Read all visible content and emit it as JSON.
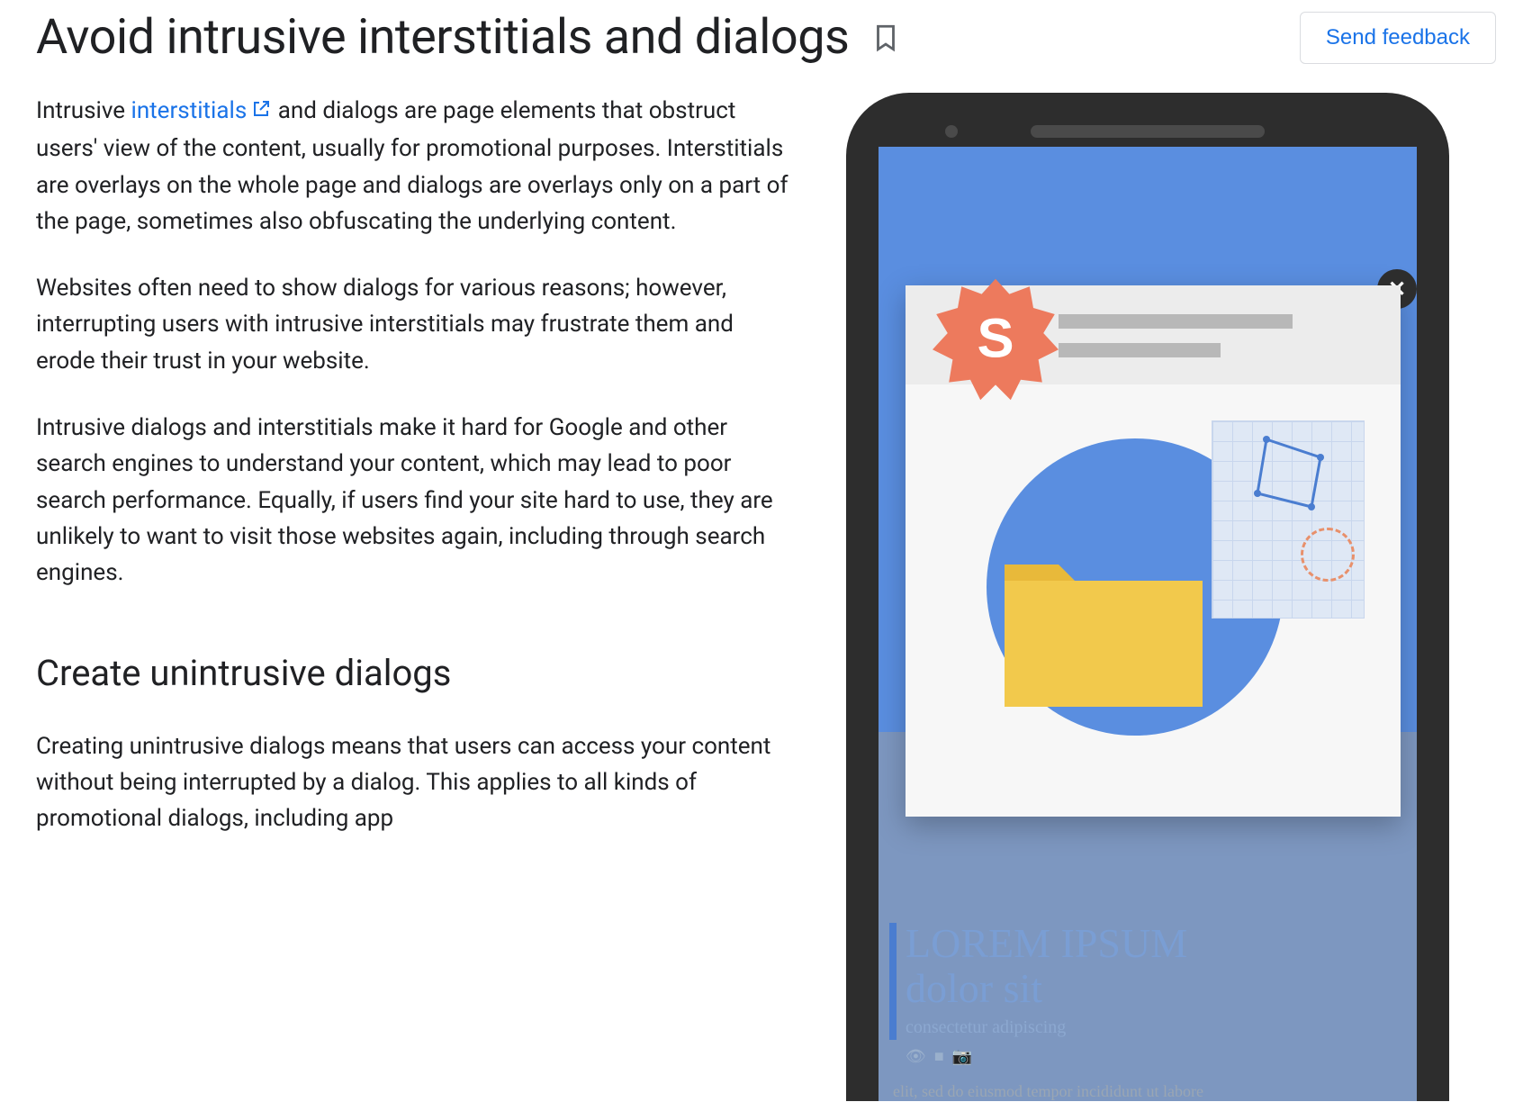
{
  "header": {
    "title": "Avoid intrusive interstitials and dialogs",
    "feedback_label": "Send feedback"
  },
  "intro": {
    "prefix": "Intrusive ",
    "link_text": "interstitials",
    "suffix": " and dialogs are page elements that obstruct users' view of the content, usually for promotional purposes. Interstitials are overlays on the whole page and dialogs are overlays only on a part of the page, sometimes also obfuscating the underlying content."
  },
  "para2": "Websites often need to show dialogs for various reasons; however, interrupting users with intrusive interstitials may frustrate them and erode their trust in your website.",
  "para3": "Intrusive dialogs and interstitials make it hard for Google and other search engines to understand your content, which may lead to poor search performance. Equally, if users find your site hard to use, they are unlikely to want to visit those websites again, including through search engines.",
  "section2": {
    "heading": "Create unintrusive dialogs",
    "para": "Creating unintrusive dialogs means that users can access your content without being interrupted by a dialog. This applies to all kinds of promotional dialogs, including app"
  },
  "illustration": {
    "article_title_line1": "LOREM IPSUM",
    "article_title_line2": "dolor sit",
    "article_sub": "consectetur adipiscing",
    "article_body": "elit, sed do eiusmod tempor incididunt ut labore",
    "close_glyph": "✕",
    "dollar_glyph": "S"
  }
}
